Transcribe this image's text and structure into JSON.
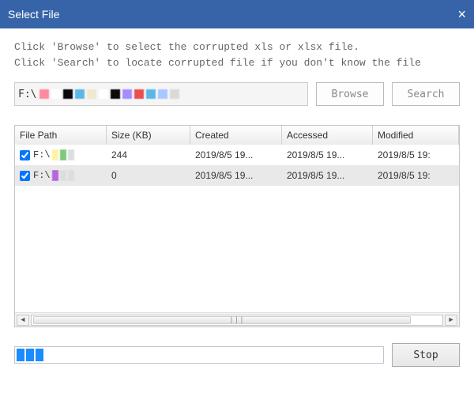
{
  "window": {
    "title": "Select File",
    "close_symbol": "×"
  },
  "instructions": {
    "line1": "Click 'Browse' to select the corrupted xls or xlsx file.",
    "line2": "Click 'Search' to locate corrupted file if you don't know the file"
  },
  "path_input": {
    "prefix": "F:\\",
    "swatches": [
      "#ff8aa0",
      "#ffffff",
      "#0a0a0a",
      "#5bb8e6",
      "#efe9d0",
      "#ffffff",
      "#0b0b0b",
      "#a78cff",
      "#e94f4f",
      "#5bb8e6",
      "#a8c6ff",
      "#d9d9d9"
    ]
  },
  "buttons": {
    "browse": "Browse",
    "search": "Search",
    "stop": "Stop"
  },
  "table": {
    "columns": {
      "path": "File Path",
      "size": "Size (KB)",
      "created": "Created",
      "accessed": "Accessed",
      "modified": "Modified"
    },
    "rows": [
      {
        "checked": true,
        "path_prefix": "F:\\",
        "swatches": [
          "#fff2a8",
          "#7fc97f",
          "#dddddd"
        ],
        "size": "244",
        "created": "2019/8/5 19...",
        "accessed": "2019/8/5 19...",
        "modified": "2019/8/5 19:"
      },
      {
        "checked": true,
        "path_prefix": "F:\\",
        "swatches": [
          "#b668d9",
          "#dddddd",
          "#dddddd"
        ],
        "size": "0",
        "created": "2019/8/5 19...",
        "accessed": "2019/8/5 19...",
        "modified": "2019/8/5 19:"
      }
    ],
    "scroll": {
      "left_arrow": "◄",
      "right_arrow": "►",
      "grip": "|||"
    }
  },
  "progress": {
    "segments": 3
  }
}
